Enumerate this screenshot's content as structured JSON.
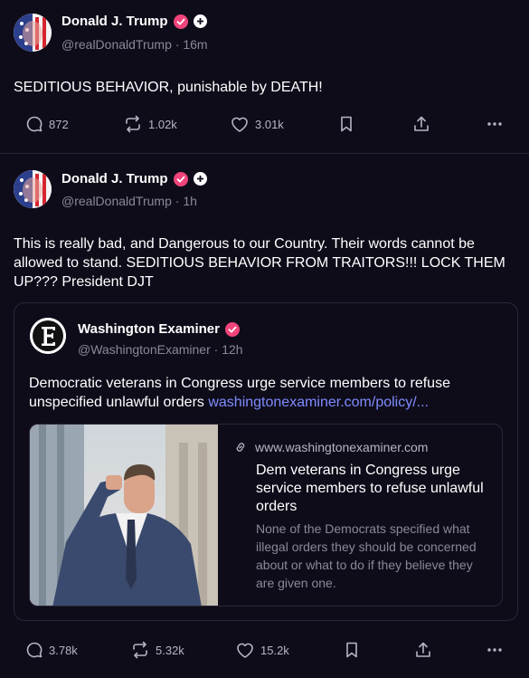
{
  "posts": [
    {
      "author": "Donald J. Trump",
      "handle": "@realDonaldTrump",
      "time": "16m",
      "text": "SEDITIOUS BEHAVIOR, punishable by DEATH!",
      "replies": "872",
      "reposts": "1.02k",
      "likes": "3.01k"
    },
    {
      "author": "Donald J. Trump",
      "handle": "@realDonaldTrump",
      "time": "1h",
      "text": "This is really bad, and Dangerous to our Country. Their words cannot be allowed to stand. SEDITIOUS BEHAVIOR FROM TRAITORS!!! LOCK THEM UP??? President DJT",
      "replies": "3.78k",
      "reposts": "5.32k",
      "likes": "15.2k",
      "quote": {
        "author": "Washington Examiner",
        "handle": "@WashingtonExaminer",
        "time": "12h",
        "text": "Democratic veterans in Congress urge service members to refuse unspecified unlawful orders",
        "link": "washingtonexaminer.com/policy/...",
        "card": {
          "domain": "www.washingtonexaminer.com",
          "title": "Dem veterans in Congress urge service members to refuse unlawful orders",
          "description": "None of the Democrats specified what illegal orders they should be concerned about or what to do if they believe they are given one."
        }
      }
    }
  ],
  "separator": "·",
  "colors": {
    "background": "#0f0c1a",
    "verified": "#f0447a",
    "link": "#7e8cff",
    "muted": "#8a8799"
  },
  "icons": [
    "reply-icon",
    "repost-icon",
    "like-icon",
    "bookmark-icon",
    "share-icon",
    "more-icon",
    "verified-icon",
    "plus-icon",
    "link-icon"
  ]
}
